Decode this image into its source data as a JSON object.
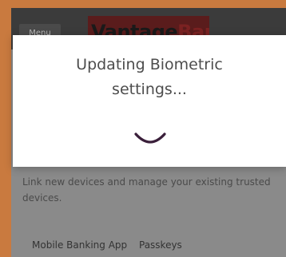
{
  "header": {
    "menu_label": "Menu",
    "logo_word": "Vantage",
    "logo_bank": "Bank"
  },
  "page": {
    "description": "Link new devices and manage your existing trusted devices."
  },
  "tabs": [
    {
      "label": "Mobile Banking App",
      "active": true
    },
    {
      "label": "Passkeys",
      "active": false
    }
  ],
  "modal": {
    "title": "Updating Biometric settings..."
  },
  "colors": {
    "frame_border": "#c97a3f",
    "spinner": "#3a1f3a",
    "modal_background": "#ffffff"
  },
  "icons": {
    "spinner": "loading-spinner-icon"
  }
}
